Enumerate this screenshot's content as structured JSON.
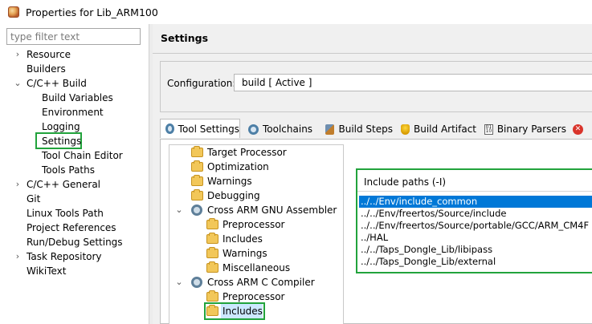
{
  "window": {
    "title": "Properties for Lib_ARM100"
  },
  "filter": {
    "placeholder": "type filter text"
  },
  "nav": {
    "items": [
      {
        "label": "Resource",
        "arrow": "›"
      },
      {
        "label": "Builders"
      },
      {
        "label": "C/C++ Build",
        "arrow": "⌄"
      },
      {
        "label": "Build Variables"
      },
      {
        "label": "Environment"
      },
      {
        "label": "Logging"
      },
      {
        "label": "Settings",
        "selected": true
      },
      {
        "label": "Tool Chain Editor"
      },
      {
        "label": "Tools Paths"
      },
      {
        "label": "C/C++ General",
        "arrow": "›"
      },
      {
        "label": "Git"
      },
      {
        "label": "Linux Tools Path"
      },
      {
        "label": "Project References"
      },
      {
        "label": "Run/Debug Settings"
      },
      {
        "label": "Task Repository",
        "arrow": "›"
      },
      {
        "label": "WikiText"
      }
    ]
  },
  "page": {
    "title": "Settings"
  },
  "configuration": {
    "label": "Configuration:",
    "value": "build  [ Active ]"
  },
  "tabs": [
    {
      "label": "Tool Settings",
      "icon": "gear-icon",
      "active": true
    },
    {
      "label": "Toolchains",
      "icon": "gear-icon"
    },
    {
      "label": "Build Steps",
      "icon": "build-steps-icon"
    },
    {
      "label": "Build Artifact",
      "icon": "trophy-icon"
    },
    {
      "label": "Binary Parsers",
      "icon": "binary-icon"
    },
    {
      "icon": "error-icon"
    }
  ],
  "tool_tree": [
    {
      "label": "Target Processor",
      "icon": "folder-icon"
    },
    {
      "label": "Optimization",
      "icon": "folder-icon"
    },
    {
      "label": "Warnings",
      "icon": "folder-icon"
    },
    {
      "label": "Debugging",
      "icon": "folder-icon"
    },
    {
      "label": "Cross ARM GNU Assembler",
      "icon": "gear-icon",
      "arrow": "⌄"
    },
    {
      "label": "Preprocessor",
      "icon": "folder-icon"
    },
    {
      "label": "Includes",
      "icon": "folder-icon"
    },
    {
      "label": "Warnings",
      "icon": "folder-icon"
    },
    {
      "label": "Miscellaneous",
      "icon": "folder-icon"
    },
    {
      "label": "Cross ARM C Compiler",
      "icon": "gear-icon",
      "arrow": "⌄"
    },
    {
      "label": "Preprocessor",
      "icon": "folder-icon"
    },
    {
      "label": "Includes",
      "icon": "folder-icon",
      "selected": true
    }
  ],
  "include_paths": {
    "header": "Include paths (-I)",
    "items": [
      "../../Env/include_common",
      "../../Env/freertos/Source/include",
      "../../Env/freertos/Source/portable/GCC/ARM_CM4F",
      "../HAL",
      "../../Taps_Dongle_Lib/libipass",
      "../../Taps_Dongle_Lib/external"
    ]
  },
  "colors": {
    "highlight_green": "#22a33c",
    "selection_blue": "#0078d7"
  }
}
